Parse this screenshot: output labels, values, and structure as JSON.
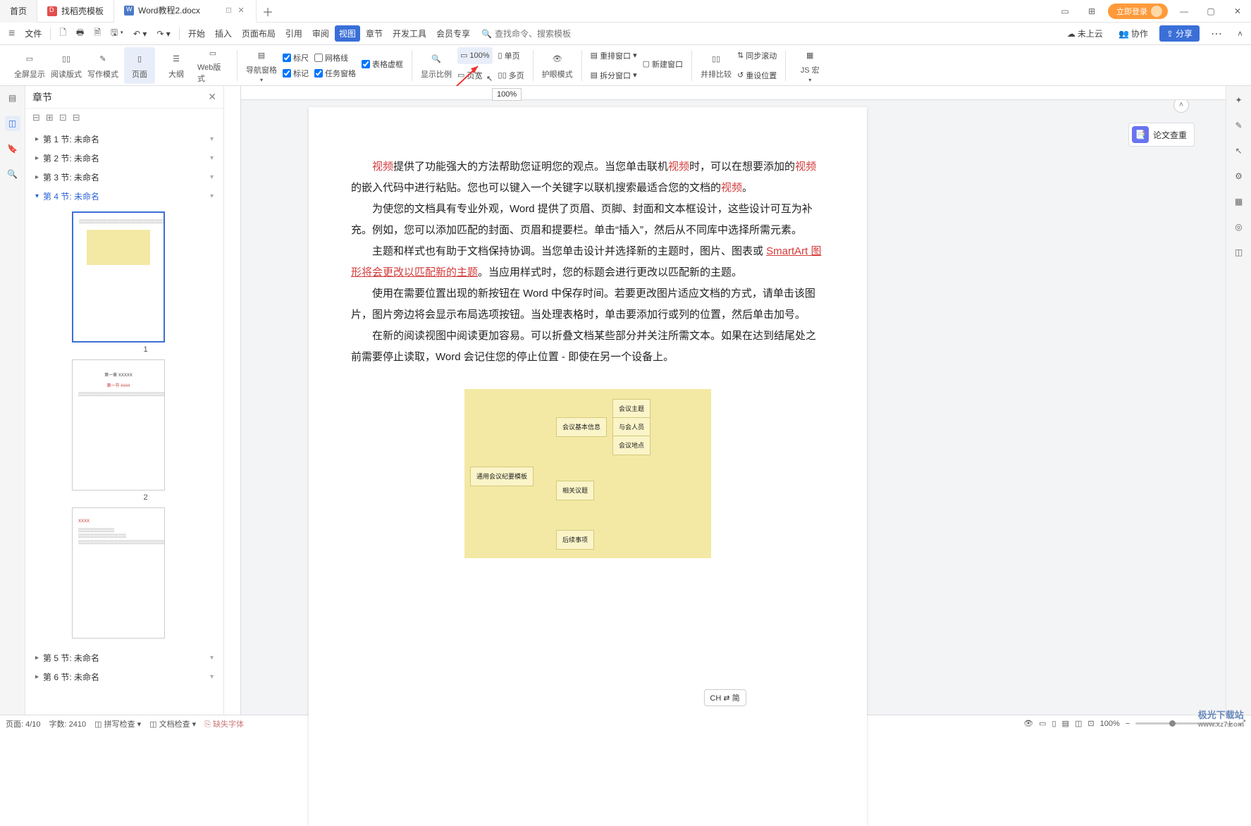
{
  "tabs": {
    "home": "首页",
    "template": "找稻壳模板",
    "doc": "Word教程2.docx"
  },
  "titlebar": {
    "login": "立即登录"
  },
  "menu": {
    "file": "文件",
    "start": "开始",
    "insert": "插入",
    "layout": "页面布局",
    "reference": "引用",
    "review": "审阅",
    "view": "视图",
    "chapter": "章节",
    "dev": "开发工具",
    "vip": "会员专享",
    "search_ph": "查找命令、搜索模板",
    "cloud": "未上云",
    "coop": "协作",
    "share": "分享"
  },
  "ribbon": {
    "fullscreen": "全屏显示",
    "read": "阅读版式",
    "write": "写作模式",
    "page": "页面",
    "outline": "大纲",
    "web": "Web版式",
    "navpane": "导航窗格",
    "ruler": "标尺",
    "grid": "网格线",
    "tablevirt": "表格虚框",
    "marker": "标记",
    "taskpane": "任务窗格",
    "zoomratio": "显示比例",
    "pct100": "100%",
    "pagewidth": "页宽",
    "single": "单页",
    "multi": "多页",
    "eyecare": "护眼模式",
    "rearrange": "重排窗口",
    "split": "拆分窗口",
    "newwin": "新建窗口",
    "sideby": "并排比较",
    "syncscroll": "同步滚动",
    "resetpos": "重设位置",
    "jsmacro": "JS 宏",
    "tooltip": "100%"
  },
  "side": {
    "title": "章节",
    "items": [
      {
        "label": "第 1 节: 未命名"
      },
      {
        "label": "第 2 节: 未命名"
      },
      {
        "label": "第 3 节: 未命名"
      },
      {
        "label": "第 4 节: 未命名"
      },
      {
        "label": "第 5 节: 未命名"
      },
      {
        "label": "第 6 节: 未命名"
      }
    ],
    "pg1": "1",
    "pg2": "2"
  },
  "doc": {
    "p1a": "视频",
    "p1b": "提供了功能强大的方法帮助您证明您的观点。当您单击联机",
    "p1c": "视频",
    "p1d": "时，可以在想要添加的",
    "p1e": "视频",
    "p1f": "的嵌入代码中进行粘贴。您也可以键入一个关键字以联机搜索最适合您的文档的",
    "p1g": "视频",
    "p1h": "。",
    "p2": "为使您的文档具有专业外观，Word 提供了页眉、页脚、封面和文本框设计，这些设计可互为补充。例如，您可以添加匹配的封面、页眉和提要栏。单击“插入”，然后从不同库中选择所需元素。",
    "p3a": "主题和样式也有助于文档保持协调。当您单击设计并选择新的主题时，图片、图表或 ",
    "p3b": "SmartArt",
    "p3c": " 图形将会更改以匹配新的主题",
    "p3d": "。当应用样式时，您的标题会进行更改以匹配新的主题。",
    "p4": "使用在需要位置出现的新按钮在 Word 中保存时间。若要更改图片适应文档的方式，请单击该图片，图片旁边将会显示布局选项按钮。当处理表格时，单击要添加行或列的位置，然后单击加号。",
    "p5": "在新的阅读视图中阅读更加容易。可以折叠文档某些部分并关注所需文本。如果在达到结尾处之前需要停止读取，Word 会记住您的停止位置 - 即使在另一个设备上。",
    "mm_root": "通用会议纪要模板",
    "mm_a": "会议基本信息",
    "mm_a1": "会议主题",
    "mm_a2": "与会人员",
    "mm_a3": "会议地点",
    "mm_b": "相关议题",
    "mm_c": "后续事项",
    "ime": "CH ⇄ 简"
  },
  "lunwen": "论文查重",
  "status": {
    "page": "页面: 4/10",
    "words": "字数: 2410",
    "spell": "拼写检查",
    "doccheck": "文档检查",
    "missfont": "缺失字体",
    "zoom": "100%"
  },
  "watermark": {
    "brand": "极光下载站",
    "site": "www.xz7.com"
  }
}
